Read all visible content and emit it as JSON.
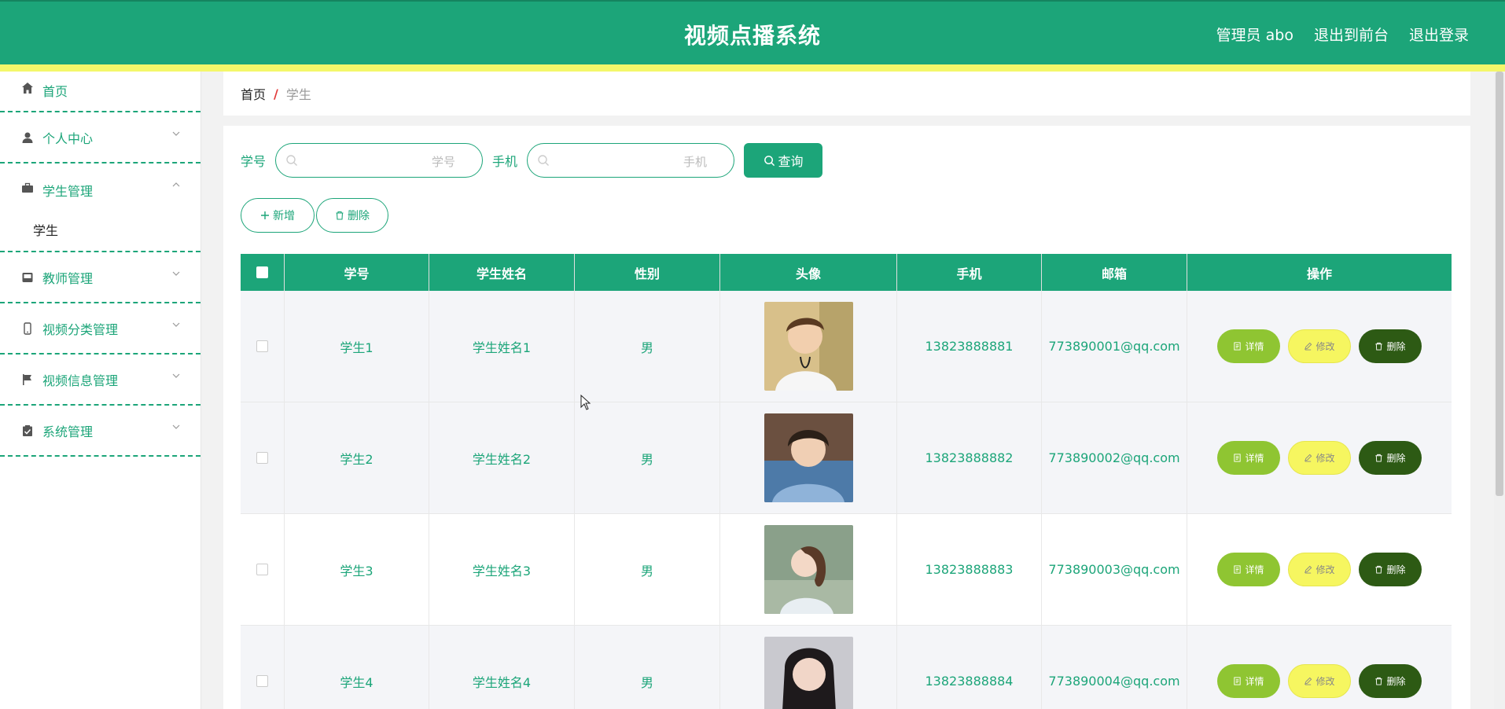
{
  "header": {
    "title": "视频点播系统",
    "links": [
      "管理员 abo",
      "退出到前台",
      "退出登录"
    ]
  },
  "sidebar": {
    "items": [
      {
        "label": "首页",
        "icon": "home-icon"
      },
      {
        "label": "个人中心",
        "icon": "user-icon"
      },
      {
        "label": "学生管理",
        "icon": "briefcase-icon",
        "open": true,
        "sub": [
          "学生"
        ]
      },
      {
        "label": "教师管理",
        "icon": "inbox-icon"
      },
      {
        "label": "视频分类管理",
        "icon": "mobile-icon"
      },
      {
        "label": "视频信息管理",
        "icon": "flag-icon"
      },
      {
        "label": "系统管理",
        "icon": "clipboard-icon"
      }
    ]
  },
  "breadcrumb": {
    "home": "首页",
    "separator": "/",
    "current": "学生"
  },
  "search": {
    "field1_label": "学号",
    "field1_placeholder": "学号",
    "field2_label": "手机",
    "field2_placeholder": "手机",
    "query_label": "查询"
  },
  "actions": {
    "add_label": "新增",
    "delete_label": "删除"
  },
  "table": {
    "headers": [
      "学号",
      "学生姓名",
      "性别",
      "头像",
      "手机",
      "邮箱",
      "操作"
    ],
    "rows": [
      {
        "id": "学生1",
        "name": "学生姓名1",
        "gender": "男",
        "phone": "13823888881",
        "email": "773890001@qq.com"
      },
      {
        "id": "学生2",
        "name": "学生姓名2",
        "gender": "男",
        "phone": "13823888882",
        "email": "773890002@qq.com"
      },
      {
        "id": "学生3",
        "name": "学生姓名3",
        "gender": "男",
        "phone": "13823888883",
        "email": "773890003@qq.com"
      },
      {
        "id": "学生4",
        "name": "学生姓名4",
        "gender": "男",
        "phone": "13823888884",
        "email": "773890004@qq.com"
      }
    ],
    "row_actions": {
      "detail": "详情",
      "edit": "修改",
      "remove": "删除"
    }
  },
  "colors": {
    "primary": "#1ca579",
    "accent_yellow": "#f4f76a",
    "detail_green": "#8fc532",
    "edit_yellow": "#f6f660",
    "delete_dark": "#2d5a14"
  }
}
